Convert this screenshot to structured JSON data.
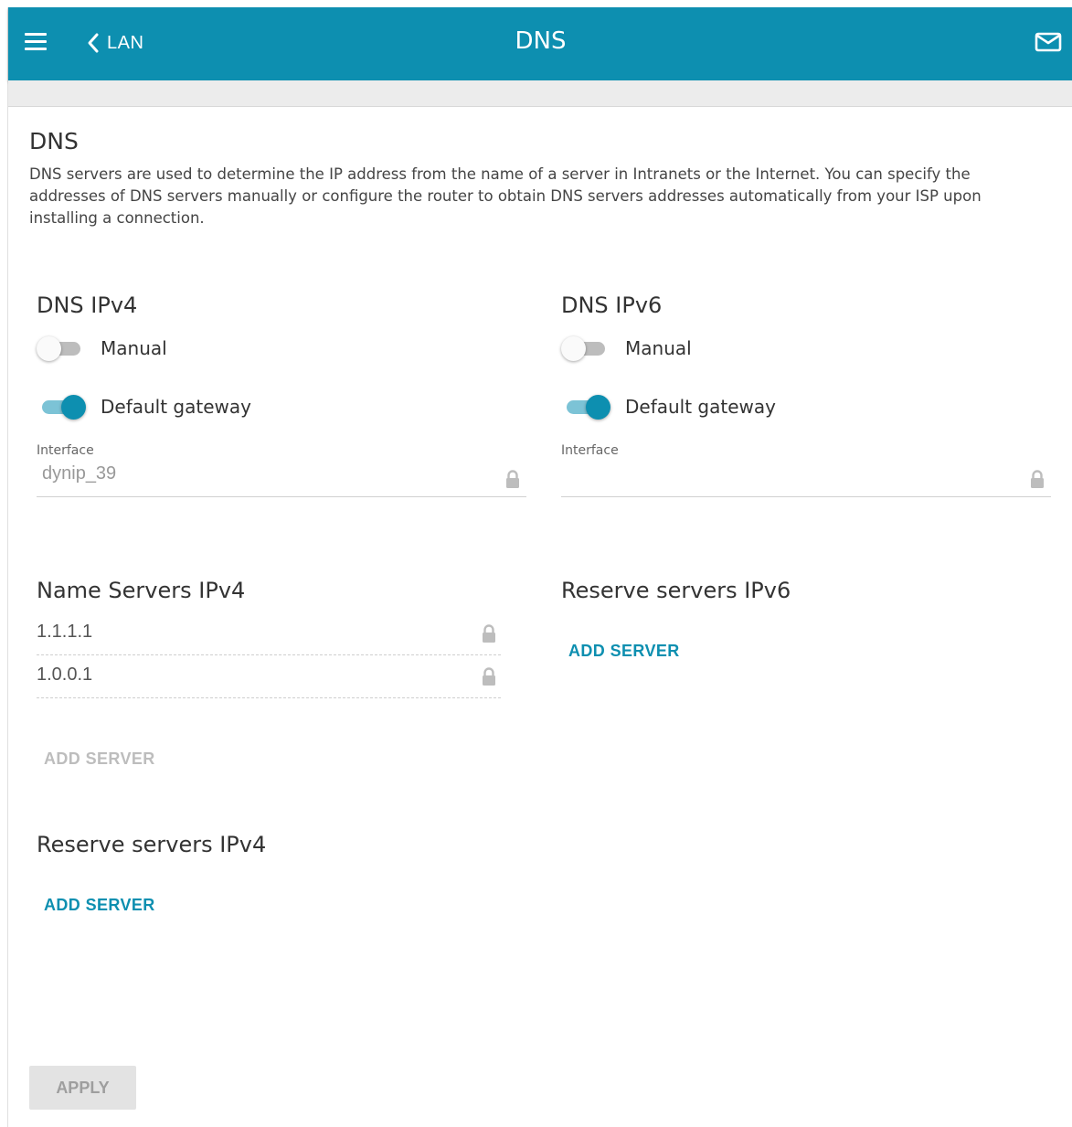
{
  "header": {
    "back_label": "LAN",
    "title": "DNS",
    "icons": {
      "menu": "hamburger-menu-icon",
      "back": "chevron-left-icon",
      "mail": "mail-icon"
    }
  },
  "main": {
    "section_title": "DNS",
    "description": "DNS servers are used to determine the IP address from the name of a server in Intranets or the Internet. You can specify the addresses of DNS servers manually or configure the router to obtain DNS servers addresses automatically from your ISP upon installing a connection."
  },
  "ipv4": {
    "title": "DNS IPv4",
    "manual": {
      "label": "Manual",
      "on": false
    },
    "default_gateway": {
      "label": "Default gateway",
      "on": true
    },
    "interface_label": "Interface",
    "interface_value": "dynip_39",
    "name_servers_title": "Name Servers IPv4",
    "name_servers": [
      "1.1.1.1",
      "1.0.0.1"
    ],
    "add_server_label": "ADD SERVER",
    "reserve_title": "Reserve servers IPv4",
    "reserve_add_label": "ADD SERVER"
  },
  "ipv6": {
    "title": "DNS IPv6",
    "manual": {
      "label": "Manual",
      "on": false
    },
    "default_gateway": {
      "label": "Default gateway",
      "on": true
    },
    "interface_label": "Interface",
    "interface_value": "",
    "reserve_title": "Reserve servers IPv6",
    "reserve_add_label": "ADD SERVER"
  },
  "footer": {
    "apply_label": "APPLY"
  },
  "colors": {
    "accent": "#0d8fb0",
    "accent_light": "#7cc3d6",
    "disabled": "#bdbdbd"
  }
}
